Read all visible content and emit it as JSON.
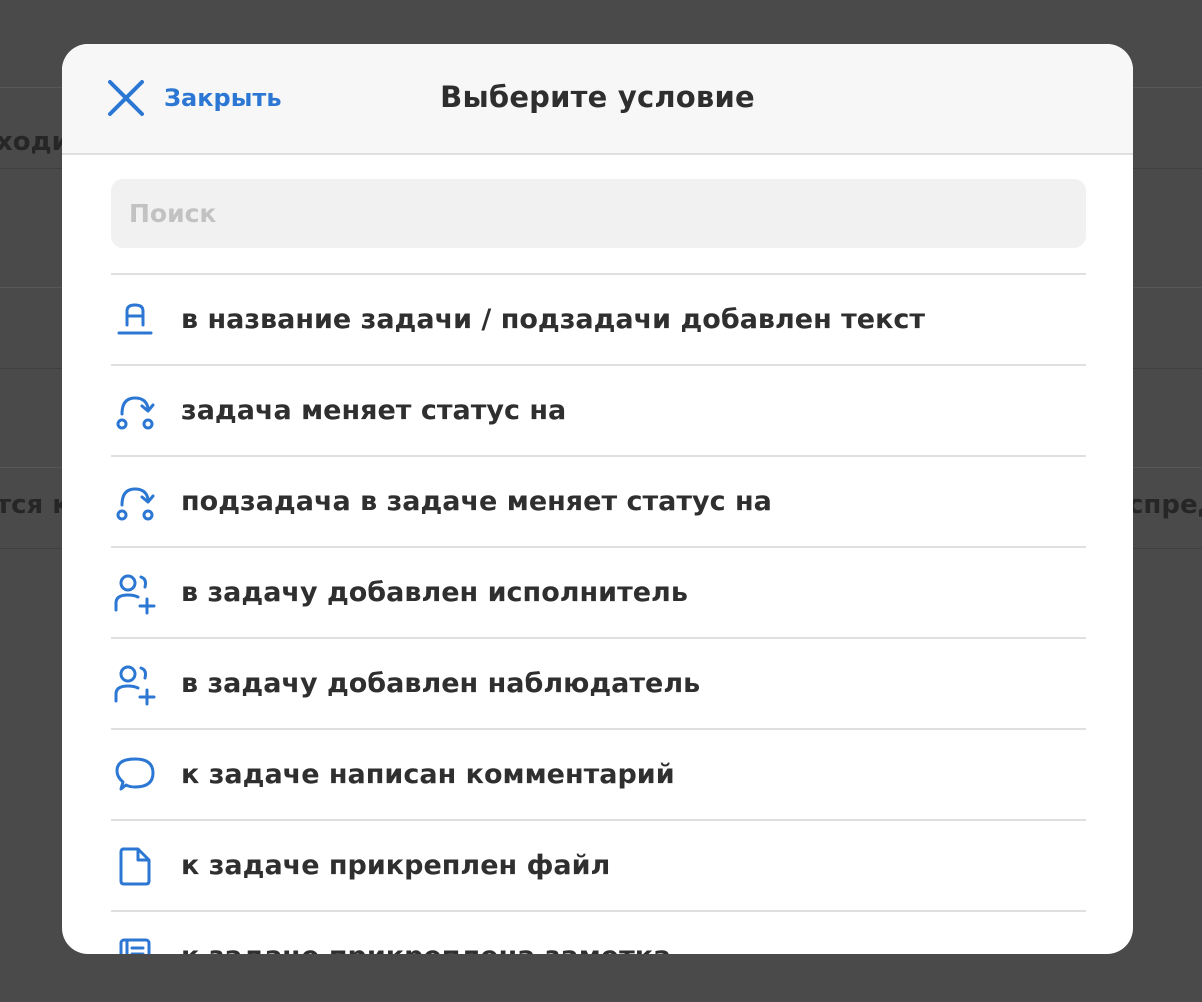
{
  "background": {
    "text_left_1": "ходи",
    "text_left_2": "тся к",
    "text_right_2": "спред"
  },
  "modal": {
    "close_label": "Закрыть",
    "title": "Выберите условие",
    "search_placeholder": "Поиск",
    "search_value": ""
  },
  "items": [
    {
      "icon": "text-underline-icon",
      "label": "в название задачи / подзадачи добавлен текст"
    },
    {
      "icon": "status-change-icon",
      "label": "задача меняет статус на"
    },
    {
      "icon": "status-change-icon",
      "label": "подзадача в задаче меняет статус на"
    },
    {
      "icon": "add-users-icon",
      "label": "в задачу добавлен исполнитель"
    },
    {
      "icon": "add-users-icon",
      "label": "в задачу добавлен наблюдатель"
    },
    {
      "icon": "comment-icon",
      "label": "к задаче написан комментарий"
    },
    {
      "icon": "file-icon",
      "label": "к задаче прикреплен файл"
    },
    {
      "icon": "note-icon",
      "label": "к задаче прикреплена заметка"
    }
  ],
  "colors": {
    "accent": "#2b77d3",
    "overlay": "#4a4a4a",
    "header_bg": "#f7f7f7",
    "search_bg": "#f1f1f1"
  }
}
